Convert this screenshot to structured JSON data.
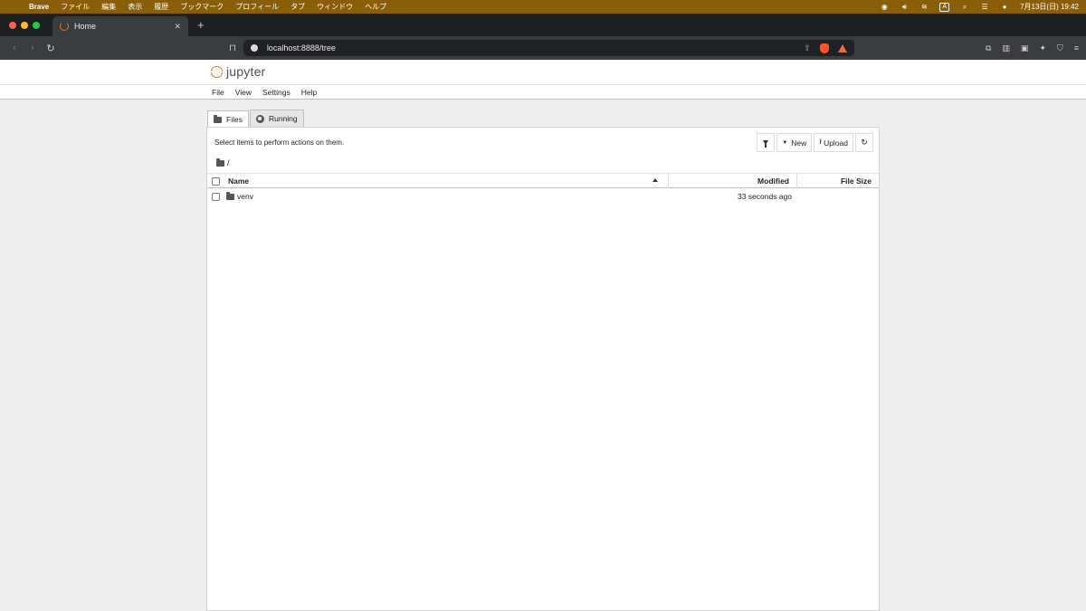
{
  "menubar": {
    "app": "Brave",
    "items": [
      "ファイル",
      "編集",
      "表示",
      "履歴",
      "ブックマーク",
      "プロフィール",
      "タブ",
      "ウィンドウ",
      "ヘルプ"
    ],
    "input_mode": "A",
    "datetime": "7月13日(日) 19:42"
  },
  "browser": {
    "tab_title": "Home",
    "url": "localhost:8888/tree"
  },
  "jupyter": {
    "logo_text": "jupyter",
    "menu": [
      "File",
      "View",
      "Settings",
      "Help"
    ],
    "tabs": [
      {
        "label": "Files",
        "icon": "folder-icon"
      },
      {
        "label": "Running",
        "icon": "running-icon"
      }
    ],
    "hint": "Select items to perform actions on them.",
    "buttons": {
      "new": "New",
      "upload": "Upload"
    },
    "breadcrumb": "/",
    "columns": {
      "name": "Name",
      "modified": "Modified",
      "size": "File Size"
    },
    "rows": [
      {
        "name": "venv",
        "modified": "33 seconds ago",
        "size": ""
      }
    ]
  }
}
